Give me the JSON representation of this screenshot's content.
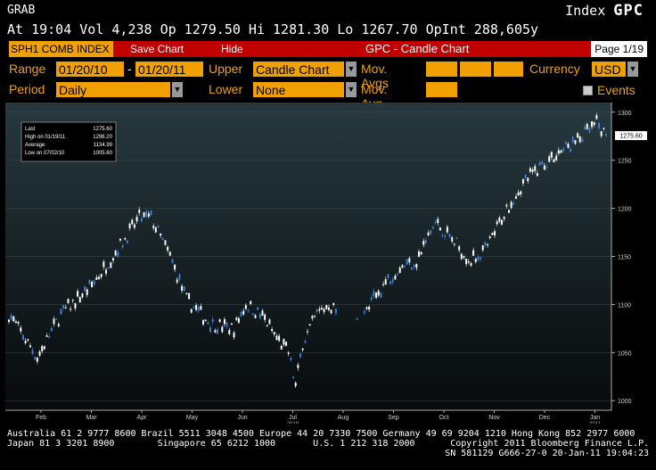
{
  "header": {
    "function_label": "GRAB",
    "index_prefix": "Index",
    "index_ticker": "GPC",
    "quote_line": "At 19:04 Vol 4,238 Op 1279.50 Hi 1281.30 Lo 1267.70 OpInt 288,605y"
  },
  "toolbar": {
    "tab_label": "SPH1 COMB INDEX",
    "save_chart": "Save Chart",
    "hide": "Hide",
    "chart_title": "GPC - Candle Chart",
    "page": "Page 1/19"
  },
  "options": {
    "range_label": "Range",
    "start_date": "01/20/10",
    "dash": "-",
    "end_date": "01/20/11",
    "upper_label": "Upper",
    "upper_value": "Candle Chart",
    "mov_avgs_label": "Mov. Avgs",
    "currency_label": "Currency",
    "currency_value": "USD",
    "period_label": "Period",
    "period_value": "Daily",
    "lower_label": "Lower",
    "lower_value": "None",
    "mov_avg_label": "Mov. Avg",
    "events_label": "Events"
  },
  "icons": {
    "dropdown": "triangle-down-icon",
    "checkbox": "checkbox-icon"
  },
  "colors": {
    "accent": "#f0a000",
    "bar": "#c00000",
    "up": "#ffffff",
    "down": "#3a7fd8"
  },
  "chart_data": {
    "type": "candlestick",
    "ylim": [
      990,
      1310
    ],
    "yticks": [
      1000,
      1050,
      1100,
      1150,
      1200,
      1250,
      1300
    ],
    "xticks": [
      "Feb",
      "Mar",
      "Apr",
      "May",
      "Jun",
      "Jul",
      "Aug",
      "Sep",
      "Oct",
      "Nov",
      "Dec",
      "Jan"
    ],
    "xticks_sub": [
      "",
      "",
      "",
      "",
      "",
      "2010",
      "",
      "",
      "",
      "",
      "",
      "2011"
    ],
    "last_label": "1275.60",
    "legend": [
      {
        "label": "Last",
        "value": "1275.60"
      },
      {
        "label": "High on 01/19/11",
        "value": "1296.20"
      },
      {
        "label": "Average",
        "value": "1134.99"
      },
      {
        "label": "Low on 07/02/10",
        "value": "1005.60"
      }
    ],
    "anchors": [
      [
        0,
        1090
      ],
      [
        12,
        1045
      ],
      [
        22,
        1090
      ],
      [
        35,
        1120
      ],
      [
        48,
        1165
      ],
      [
        55,
        1190
      ],
      [
        60,
        1190
      ],
      [
        68,
        1150
      ],
      [
        75,
        1105
      ],
      [
        85,
        1080
      ],
      [
        95,
        1075
      ],
      [
        100,
        1100
      ],
      [
        103,
        1095
      ],
      [
        108,
        1085
      ],
      [
        113,
        1065
      ],
      [
        118,
        1050
      ],
      [
        121,
        1015
      ],
      [
        124,
        1060
      ],
      [
        130,
        1090
      ],
      [
        135,
        1100
      ],
      [
        140,
        1090
      ],
      [
        150,
        1090
      ],
      [
        158,
        1120
      ],
      [
        165,
        1140
      ],
      [
        172,
        1145
      ],
      [
        180,
        1185
      ],
      [
        188,
        1165
      ],
      [
        195,
        1145
      ],
      [
        202,
        1160
      ],
      [
        210,
        1200
      ],
      [
        218,
        1230
      ],
      [
        225,
        1245
      ],
      [
        232,
        1258
      ],
      [
        240,
        1270
      ],
      [
        248,
        1288
      ],
      [
        252,
        1275
      ]
    ],
    "gaps": [
      [
        138,
        150
      ]
    ]
  },
  "footer": {
    "line1_left": "Australia 61 2 9777 8600 Brazil 5511 3048 4500 Europe 44 20 7330 7500 Germany 49 69 9204 1210 Hong Kong 852 2977 6000",
    "line2_left": "Japan 81 3 3201 8900        Singapore 65 6212 1000       U.S. 1 212 318 2000",
    "line2_right": "Copyright 2011 Bloomberg Finance L.P.",
    "line3_right": "SN 581129 G666-27-0 20-Jan-11 19:04:23"
  }
}
